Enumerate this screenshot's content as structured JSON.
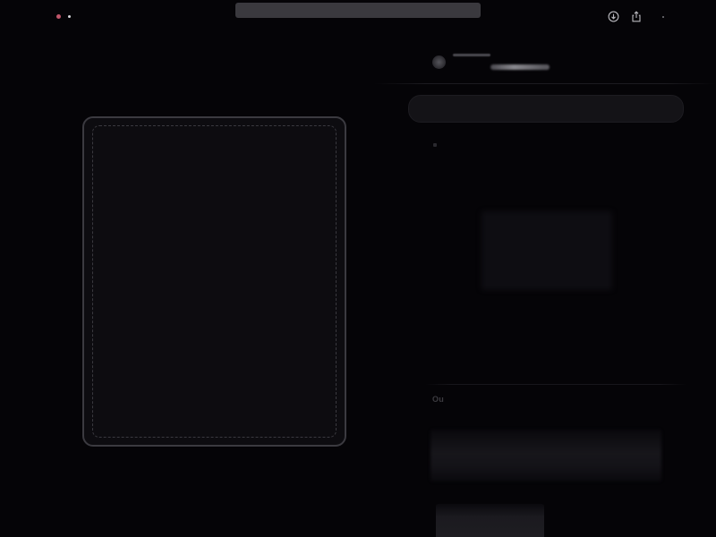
{
  "window": {
    "controls": [
      "red-dot",
      "white-dot"
    ],
    "colors": {
      "background": "#050407",
      "accent_dot": "#c0566a",
      "url_bar": "#3a393e"
    }
  },
  "toolbar": {
    "icons": [
      "download-icon",
      "share-icon",
      "more-icon"
    ]
  },
  "panel": {
    "section_label": "Ou"
  }
}
